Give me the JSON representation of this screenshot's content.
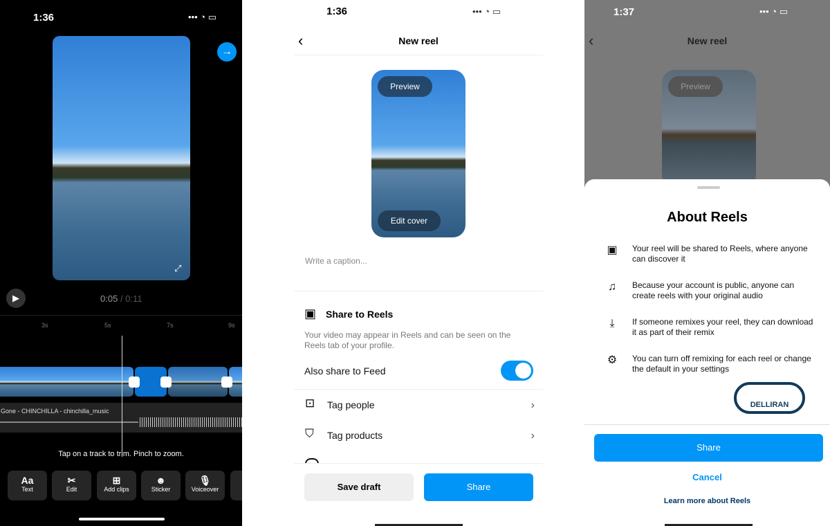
{
  "editor": {
    "time": "1:36",
    "current": "0:05",
    "total": "/ 0:11",
    "ticks": [
      "3s",
      "5s",
      "7s",
      "9s"
    ],
    "audio": "Gone - CHINCHILLA - chinchilla_music",
    "hint": "Tap on a track to trim. Pinch to zoom.",
    "tools": [
      {
        "label": "Text",
        "icon": "Aa"
      },
      {
        "label": "Edit",
        "icon": "✂"
      },
      {
        "label": "Add clips",
        "icon": "⊞"
      },
      {
        "label": "Sticker",
        "icon": "☻"
      },
      {
        "label": "Voiceover",
        "icon": "🎙"
      }
    ],
    "accent": "#0095f6"
  },
  "newreel": {
    "time": "1:36",
    "title": "New reel",
    "preview": "Preview",
    "edit_cover": "Edit cover",
    "caption_placeholder": "Write a caption...",
    "share_title": "Share to Reels",
    "share_desc": "Your video may appear in Reels and can be seen on the Reels tab of your profile.",
    "feed_label": "Also share to Feed",
    "feed_on": true,
    "items": [
      "Tag people",
      "Tag products"
    ],
    "save_draft": "Save draft",
    "share": "Share"
  },
  "about": {
    "time": "1:37",
    "title_bg": "New reel",
    "preview": "Preview",
    "title": "About Reels",
    "rows": [
      {
        "icon": "reels-icon",
        "text": "Your reel will be shared to Reels, where anyone can discover it"
      },
      {
        "icon": "audio-icon",
        "text": "Because your account is public, anyone can create reels with your original audio"
      },
      {
        "icon": "download-icon",
        "text": "If someone remixes your reel, they can download it as part of their remix"
      },
      {
        "icon": "settings-icon",
        "text": "You can turn off remixing for each reel or change the default in your settings"
      }
    ],
    "share": "Share",
    "cancel": "Cancel",
    "learn": "Learn more about Reels",
    "watermark": "DELLIRAN"
  }
}
